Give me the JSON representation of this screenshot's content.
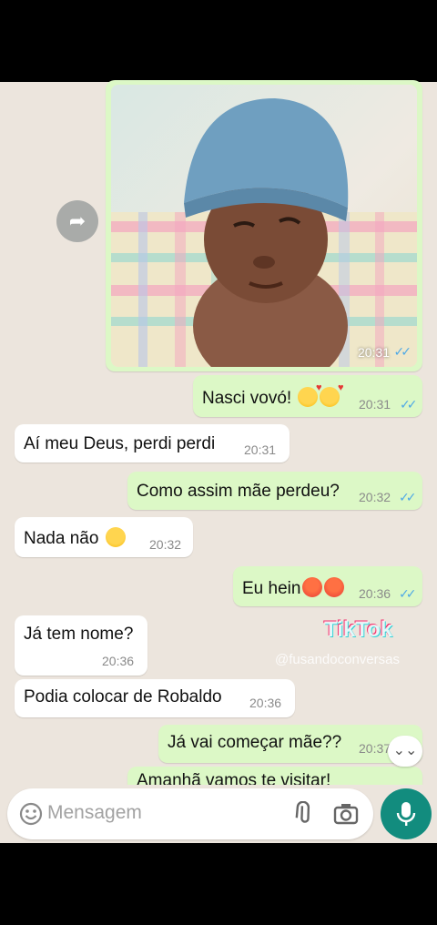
{
  "messages": [
    {
      "text": "Nasci vovó!",
      "time": "20:31",
      "dir": "out",
      "emoji": "smiling-face-with-hearts x2"
    },
    {
      "text": "Aí meu Deus, perdi perdi",
      "time": "20:31",
      "dir": "in"
    },
    {
      "text": "Como assim mãe perdeu?",
      "time": "20:32",
      "dir": "out"
    },
    {
      "text": "Nada não",
      "time": "20:32",
      "dir": "in",
      "emoji": "hugging-face"
    },
    {
      "text": "Eu hein",
      "time": "20:36",
      "dir": "out",
      "emoji": "angry-face x2"
    },
    {
      "text": "Já tem nome?",
      "time": "20:36",
      "dir": "in"
    },
    {
      "text": "Podia colocar de Robaldo",
      "time": "20:36",
      "dir": "in"
    },
    {
      "text": "Já vai começar mãe??",
      "time": "20:37",
      "dir": "out"
    },
    {
      "text": "Amanhã vamos te visitar!",
      "dir": "out"
    }
  ],
  "photo_time": "20:31",
  "ticks": "✓✓",
  "watermark": {
    "brand": "TikTok",
    "user": "@fusandoconversas"
  },
  "input": {
    "placeholder": "Mensagem"
  },
  "icons": [
    "forward-icon",
    "emoji-icon",
    "attach-icon",
    "camera-icon",
    "mic-icon",
    "scroll-down-icon"
  ],
  "colors": {
    "chat_bg": "#ece5dd",
    "outgoing": "#dcf8c6",
    "incoming": "#ffffff",
    "ticks": "#4fa9e6",
    "mic": "#128c7e"
  }
}
